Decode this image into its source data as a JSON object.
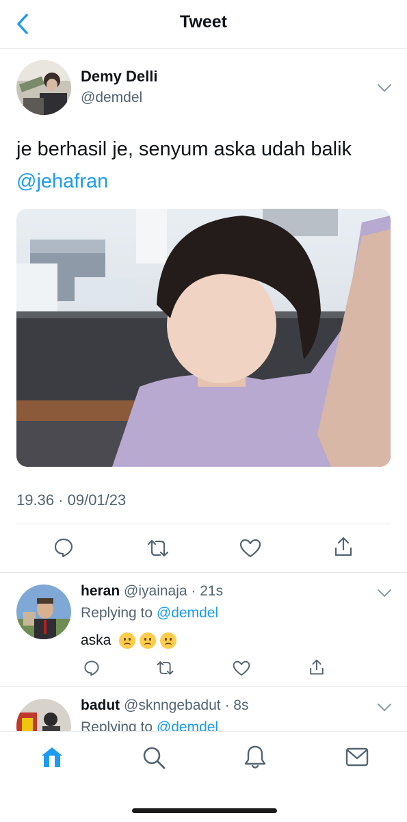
{
  "header": {
    "title": "Tweet",
    "back_icon": "chevron-left-icon"
  },
  "tweet": {
    "author_name": "Demy Delli",
    "author_handle": "@demdel",
    "text": "je berhasil je, senyum aska udah balik",
    "mention": "@jehafran",
    "timestamp": "19.36 · 09/01/23",
    "actions": [
      "reply-icon",
      "retweet-icon",
      "like-icon",
      "share-icon"
    ]
  },
  "replies": [
    {
      "name": "heran",
      "handle": "@iyainaja",
      "time": "· 21s",
      "replying_prefix": "Replying to ",
      "replying_to": "@demdel",
      "text": "aska",
      "emoji": [
        "frowning-face",
        "frowning-face",
        "frowning-face"
      ]
    },
    {
      "name": "badut",
      "handle": "@sknngebadut",
      "time": "· 8s",
      "replying_prefix": "Replying to ",
      "replying_to": "@demdel"
    }
  ],
  "tabbar": {
    "items": [
      "home-icon",
      "search-icon",
      "notifications-icon",
      "messages-icon"
    ],
    "active": "home-icon"
  },
  "colors": {
    "accent": "#1d9bf0",
    "secondary_text": "#536471",
    "divider": "#e3e6e8"
  }
}
